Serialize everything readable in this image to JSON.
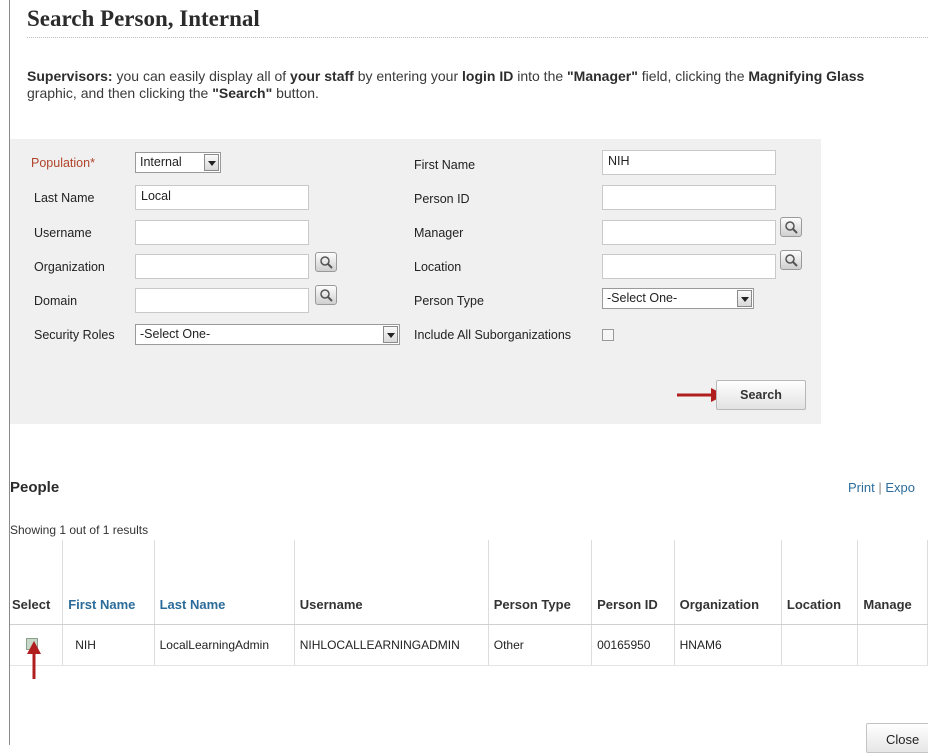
{
  "title": "Search Person, Internal",
  "intro": {
    "p1": "Supervisors:",
    "p2": " you can easily display all of ",
    "p3": "your staff",
    "p4": " by entering your ",
    "p5": "login ID",
    "p6": " into the ",
    "p7": "\"Manager\"",
    "p8": " field, clicking the ",
    "p9": "Magnifying Glass",
    "p10": " graphic, and then clicking the ",
    "p11": "\"Search\"",
    "p12": " button."
  },
  "form": {
    "population_label": "Population*",
    "population_value": "Internal",
    "last_name_label": "Last Name",
    "last_name_value": "Local",
    "username_label": "Username",
    "username_value": "",
    "organization_label": "Organization",
    "organization_value": "",
    "domain_label": "Domain",
    "domain_value": "",
    "security_roles_label": "Security Roles",
    "security_roles_value": "-Select One-",
    "first_name_label": "First Name",
    "first_name_value": "NIH",
    "person_id_label": "Person ID",
    "person_id_value": "",
    "manager_label": "Manager",
    "manager_value": "",
    "location_label": "Location",
    "location_value": "",
    "person_type_label": "Person Type",
    "person_type_value": "-Select One-",
    "include_suborgs_label": "Include All Suborganizations",
    "include_suborgs_checked": false,
    "search_button": "Search"
  },
  "results": {
    "heading": "People",
    "print_link": "Print",
    "separator": "|",
    "export_link": "Expo",
    "count_text": "Showing 1 out of 1 results",
    "columns": [
      "Select",
      "First Name",
      "Last Name",
      "Username",
      "Person Type",
      "Person ID",
      "Organization",
      "Location",
      "Manage"
    ],
    "rows": [
      {
        "first_name": "NIH",
        "last_name": "LocalLearningAdmin",
        "username": "NIHLOCALLEARNINGADMIN",
        "person_type": "Other",
        "person_id": "00165950",
        "organization": "HNAM6",
        "location": "",
        "manager": ""
      }
    ]
  },
  "close_button": "Close",
  "colors": {
    "required_label": "#b0442a",
    "link": "#2c6c9a",
    "panel_bg": "#f0f0f0",
    "annotation_arrow": "#b01e1e"
  },
  "icons": {
    "lookup": "magnifying-glass-icon",
    "annotation": "red-arrow-icon"
  }
}
